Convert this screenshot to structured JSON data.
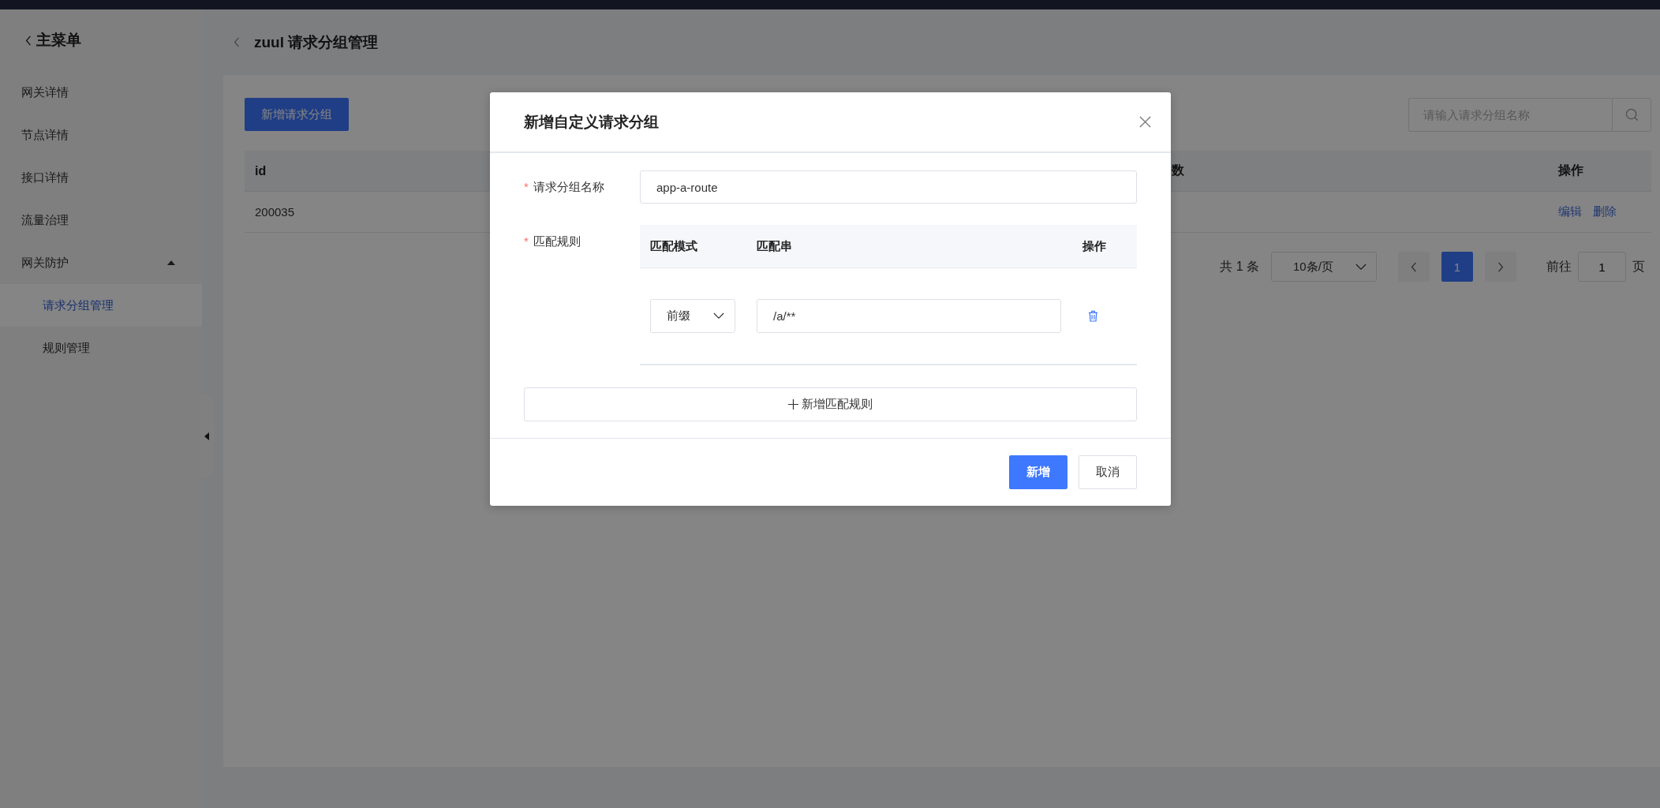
{
  "sidebar": {
    "back_label": "主菜单",
    "items": [
      {
        "label": "网关详情",
        "kind": "link",
        "selected": false
      },
      {
        "label": "节点详情",
        "kind": "link",
        "selected": false
      },
      {
        "label": "接口详情",
        "kind": "link",
        "selected": false
      },
      {
        "label": "流量治理",
        "kind": "link",
        "selected": false
      },
      {
        "label": "网关防护",
        "kind": "group",
        "selected": false,
        "expanded": true,
        "children": [
          {
            "label": "请求分组管理",
            "selected": true
          },
          {
            "label": "规则管理",
            "selected": false
          }
        ]
      }
    ]
  },
  "header": {
    "title": "zuul 请求分组管理"
  },
  "toolbar": {
    "add_button": "新增请求分组",
    "search": {
      "placeholder": "请输入请求分组名称"
    }
  },
  "table": {
    "columns": [
      "id",
      "数",
      "操作"
    ],
    "rows": [
      {
        "id": "200035",
        "actions": [
          "编辑",
          "删除"
        ]
      }
    ]
  },
  "pagination": {
    "total": "共 1 条",
    "page_size": "10条/页",
    "pages": [
      {
        "label": "1",
        "selected": true
      }
    ],
    "goto_label": "前往",
    "goto_value": "1",
    "goto_suffix": "页"
  },
  "dialog": {
    "title": "新增自定义请求分组",
    "fields": [
      {
        "label": "请求分组名称",
        "required_mark": "*",
        "value": "app-a-route"
      }
    ],
    "rules": {
      "label": "匹配规则",
      "required_mark": "*",
      "columns": [
        "匹配模式",
        "匹配串",
        "操作"
      ],
      "rows": [
        {
          "mode": "前缀",
          "pattern": "/a/**"
        }
      ]
    },
    "add_rule_button": "新增匹配规则",
    "buttons": [
      {
        "label": "新增",
        "kind": "primary"
      },
      {
        "label": "取消",
        "kind": "default"
      }
    ]
  }
}
